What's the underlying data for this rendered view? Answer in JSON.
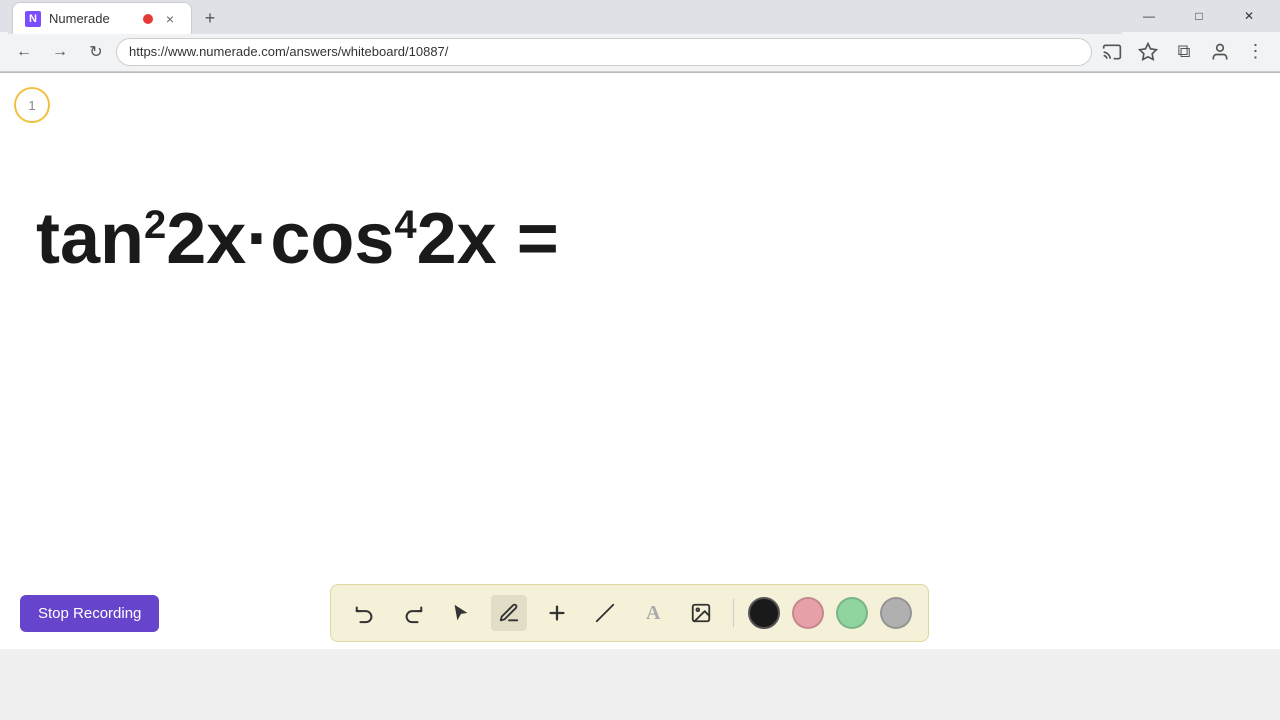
{
  "browser": {
    "tab": {
      "favicon_label": "N",
      "title": "Numerade",
      "close_label": "×",
      "new_tab_label": "+"
    },
    "address_bar": {
      "url": "https://www.numerade.com/answers/whiteboard/10887/"
    },
    "nav": {
      "back_label": "←",
      "forward_label": "→",
      "refresh_label": "↻",
      "more_label": "⋮"
    },
    "window_controls": {
      "minimize": "—",
      "maximize": "□",
      "close": "✕"
    }
  },
  "whiteboard": {
    "step_number": "1",
    "math_expression_display": "tan²2x·cos⁴2x =",
    "math_html": "tan<sup>2</sup>2x·cos<sup>4</sup>2x&nbsp;="
  },
  "toolbar": {
    "stop_recording_label": "Stop Recording",
    "tools": [
      {
        "name": "undo",
        "label": "↩",
        "title": "Undo"
      },
      {
        "name": "redo",
        "label": "↪",
        "title": "Redo"
      },
      {
        "name": "select",
        "label": "▶",
        "title": "Select"
      },
      {
        "name": "pen",
        "label": "✏",
        "title": "Pen"
      },
      {
        "name": "add",
        "label": "+",
        "title": "Add"
      },
      {
        "name": "eraser",
        "label": "╱",
        "title": "Eraser"
      },
      {
        "name": "text",
        "label": "A",
        "title": "Text"
      },
      {
        "name": "image",
        "label": "🖼",
        "title": "Image"
      }
    ],
    "colors": [
      {
        "name": "black",
        "hex": "#1a1a1a",
        "active": true
      },
      {
        "name": "pink",
        "hex": "#e8a0a8"
      },
      {
        "name": "green",
        "hex": "#90d4a0"
      },
      {
        "name": "gray",
        "hex": "#b0b0b0"
      }
    ]
  },
  "colors": {
    "accent": "#6644cc",
    "tab_bg": "#ffffff",
    "toolbar_bg": "#f5f0d8",
    "recording_dot": "#e53935"
  }
}
